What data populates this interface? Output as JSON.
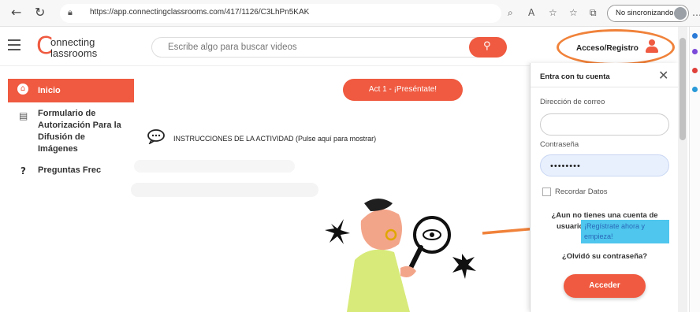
{
  "browser": {
    "url": "https://app.connectingclassrooms.com/417/1126/C3LhPn5KAK",
    "sync_label": "No sincronizando"
  },
  "header": {
    "logo_line1": "onnecting",
    "logo_line2": "lassrooms",
    "search_placeholder": "Escribe algo para buscar videos",
    "access_label": "Acceso/Registro"
  },
  "sidebar": {
    "items": [
      {
        "label": "Inicio",
        "icon": "home-icon"
      },
      {
        "label": "Formulario de Autorización Para la Difusión de Imágenes",
        "icon": "document-icon"
      },
      {
        "label": "Preguntas Frec",
        "icon": "question-icon"
      }
    ]
  },
  "main": {
    "activity_button": "Act 1 - ¡Preséntate!",
    "instructions": "INSTRUCCIONES DE LA ACTIVIDAD (Pulse aquí para mostrar)"
  },
  "login": {
    "title": "Entra con tu cuenta",
    "email_label": "Dirección de correo",
    "email_value": "",
    "password_label": "Contraseña",
    "password_value": "••••••••",
    "remember_label": "Recordar Datos",
    "no_account_text": "¿Aun no tienes una cuenta de",
    "user_text": "usuario?",
    "register_link": "¡Regístrate ahora y empieza!",
    "forgot_link": "¿Olvidó su contraseña?",
    "submit_label": "Acceder"
  },
  "colors": {
    "brand": "#ef5a40",
    "annotation": "#f0823a",
    "link_highlight": "#4ec6ee"
  }
}
